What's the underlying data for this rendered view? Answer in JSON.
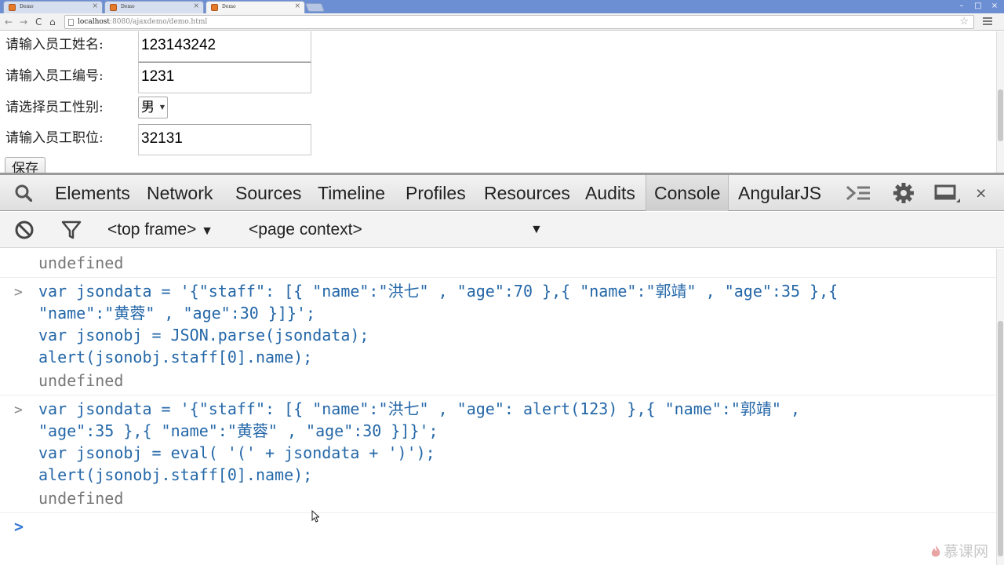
{
  "browser": {
    "tabs": [
      {
        "label": "Demo",
        "active": false
      },
      {
        "label": "Demo",
        "active": false
      },
      {
        "label": "Demo",
        "active": true
      }
    ],
    "url_host": "localhost",
    "url_rest": ":8080/ajaxdemo/demo.html"
  },
  "form": {
    "name_label": "请输入员工姓名:",
    "name_value": "123143242",
    "number_label": "请输入员工编号:",
    "number_value": "1231",
    "sex_label": "请选择员工性别:",
    "sex_value": "男",
    "job_label": "请输入员工职位:",
    "job_value": "32131",
    "save_label": "保存"
  },
  "devtools": {
    "tabs": [
      "Elements",
      "Network",
      "Sources",
      "Timeline",
      "Profiles",
      "Resources",
      "Audits",
      "Console",
      "AngularJS"
    ],
    "active_tab": "Console",
    "frame_selector": "<top frame>",
    "context_selector": "<page context>"
  },
  "console": {
    "entries": [
      {
        "type": "result",
        "text": "undefined"
      },
      {
        "type": "input",
        "lines": [
          "var jsondata = '{\"staff\": [{ \"name\":\"洪七\" , \"age\":70 },{ \"name\":\"郭靖\" , \"age\":35 },{",
          "\"name\":\"黄蓉\" , \"age\":30 }]}';",
          "var jsonobj = JSON.parse(jsondata);",
          "alert(jsonobj.staff[0].name);"
        ]
      },
      {
        "type": "result",
        "text": "undefined"
      },
      {
        "type": "input",
        "lines": [
          "var jsondata = '{\"staff\": [{ \"name\":\"洪七\" , \"age\": alert(123) },{ \"name\":\"郭靖\" ,",
          "\"age\":35 },{ \"name\":\"黄蓉\" , \"age\":30 }]}';",
          "var jsonobj = eval( '(' + jsondata + ')');",
          "alert(jsonobj.staff[0].name);"
        ]
      },
      {
        "type": "result",
        "text": "undefined"
      }
    ]
  },
  "watermark": "慕课网",
  "colors": {
    "code": "#2467a8",
    "result": "#777777",
    "prompt_active": "#3a7bd5",
    "tabstrip": "#6c8ed3"
  }
}
